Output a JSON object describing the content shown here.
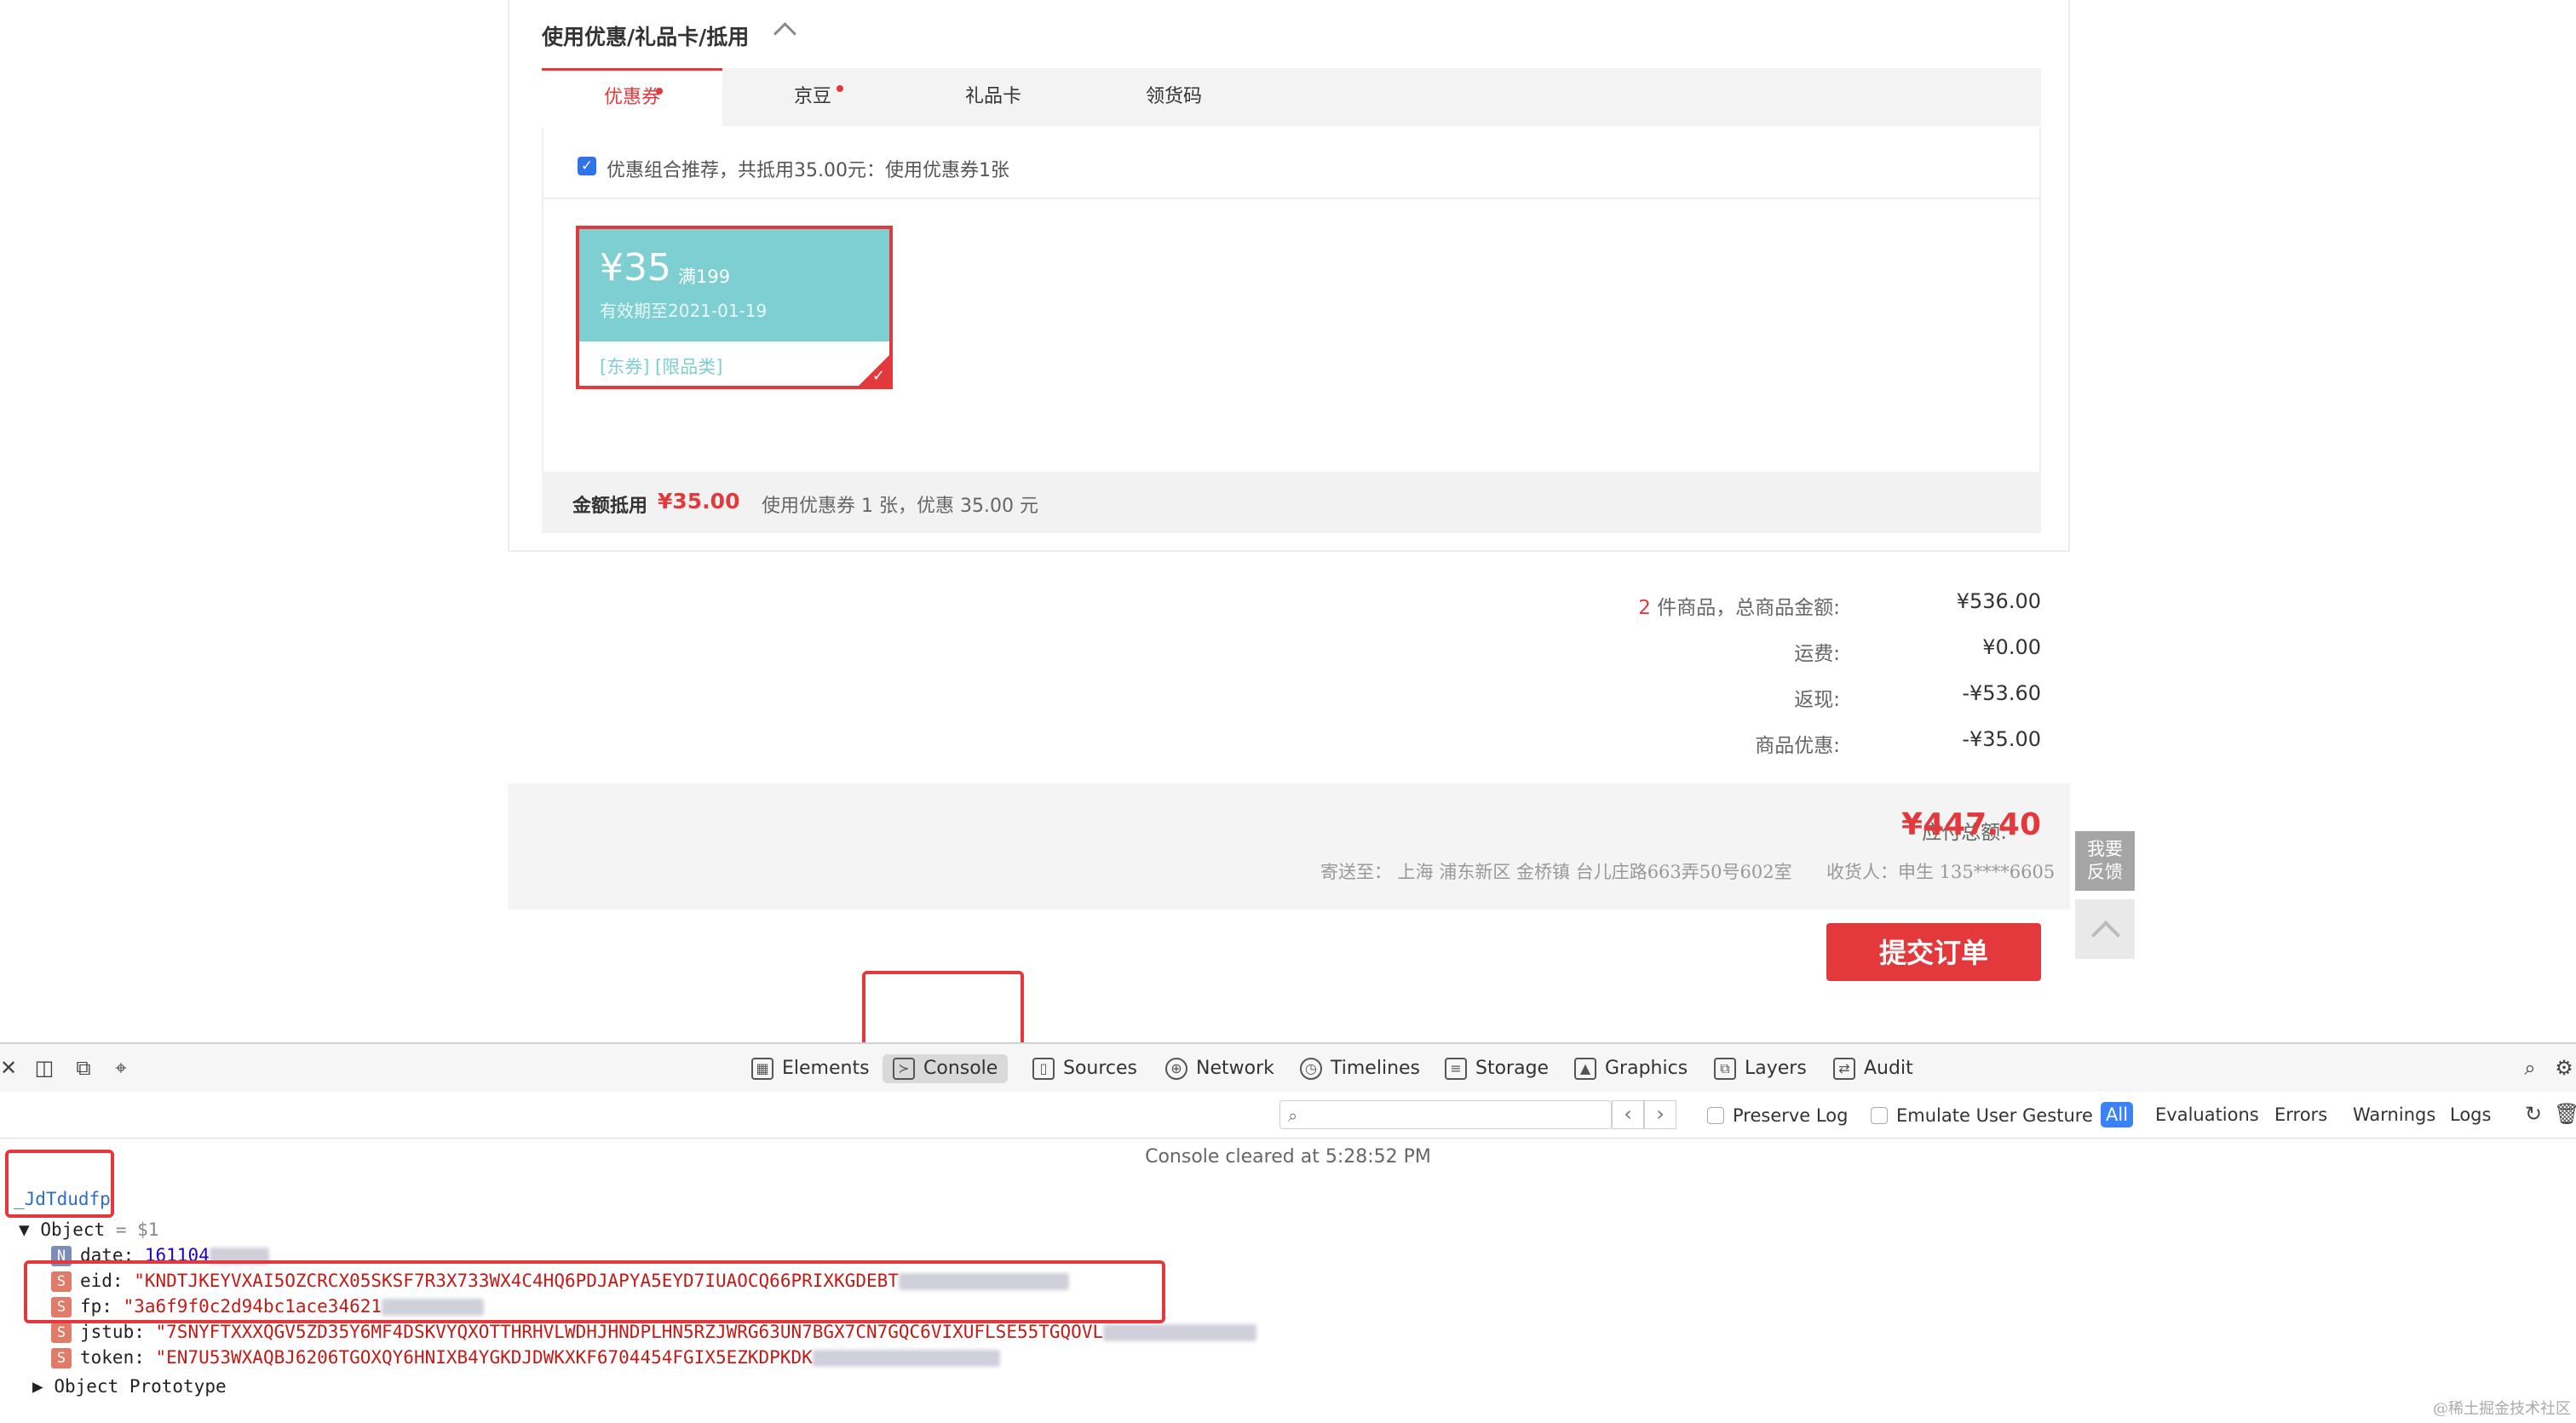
{
  "coupon_section": {
    "title": "使用优惠/礼品卡/抵用",
    "tabs": [
      {
        "label": "优惠券",
        "dot": true,
        "active": true
      },
      {
        "label": "京豆",
        "dot": true,
        "active": false
      },
      {
        "label": "礼品卡",
        "dot": false,
        "active": false
      },
      {
        "label": "领货码",
        "dot": false,
        "active": false
      }
    ],
    "recommend_text": "优惠组合推荐，共抵用35.00元：使用优惠券1张",
    "coupon": {
      "amount": "¥35",
      "condition": "满199",
      "valid": "有效期至2021-01-19",
      "tags": "[东券] [限品类]"
    },
    "summary": {
      "label": "金额抵用",
      "amount": "¥35.00",
      "note": "使用优惠券 1 张，优惠 35.00 元"
    }
  },
  "price_summary": {
    "items_count": "2",
    "items_label": " 件商品，总商品金额:",
    "items_total": "¥536.00",
    "shipping_label": "运费:",
    "shipping": "¥0.00",
    "cashback_label": "返现:",
    "cashback": "-¥53.60",
    "discount_label": "商品优惠:",
    "discount": "-¥35.00"
  },
  "total": {
    "label": "应付总额:",
    "amount": "¥447.40",
    "address": "寄送至：  上海 浦东新区 金桥镇 台儿庄路663弄50号602室",
    "receiver": "收货人：申生 135****6605"
  },
  "feedback": {
    "line1": "我要",
    "line2": "反馈"
  },
  "submit_label": "提交订单",
  "devtools": {
    "tabs": [
      "Elements",
      "Console",
      "Sources",
      "Network",
      "Timelines",
      "Storage",
      "Graphics",
      "Layers",
      "Audit"
    ],
    "active_tab": "Console",
    "filter_placeholder": "",
    "preserve_log": "Preserve Log",
    "emulate_gesture": "Emulate User Gesture",
    "levels": [
      "All",
      "Evaluations",
      "Errors",
      "Warnings",
      "Logs"
    ],
    "cleared_text": "Console cleared at 5:28:52 PM",
    "command": "_JdTdudfp",
    "object_line": "Object",
    "object_ref": "= $1",
    "lines": [
      {
        "type": "N",
        "key": "date:",
        "value": "161104"
      },
      {
        "type": "S",
        "key": "eid:",
        "value": "\"KNDTJKEYVXAI5OZCRCX05SKSF7R3X733WX4C4HQ6PDJAPYA5EYD7IUAOCQ66PRIXKGDEBT"
      },
      {
        "type": "S",
        "key": "fp:",
        "value": "\"3a6f9f0c2d94bc1ace34621"
      },
      {
        "type": "S",
        "key": "jstub:",
        "value": "\"7SNYFTXXXQGV5ZD35Y6MF4DSKVYQXOTTHRHVLWDHJHNDPLHN5RZJWRG63UN7BGX7CN7GQC6VIXUFLSE55TGQOVL"
      },
      {
        "type": "S",
        "key": "token:",
        "value": "\"EN7U53WXAQBJ6206TGOXQY6HNIXB4YGKDJDWKXKF6704454FGIX5EZKDPKDK"
      }
    ],
    "prototype_line": "Object Prototype"
  },
  "watermark": "@稀土掘金技术社区"
}
